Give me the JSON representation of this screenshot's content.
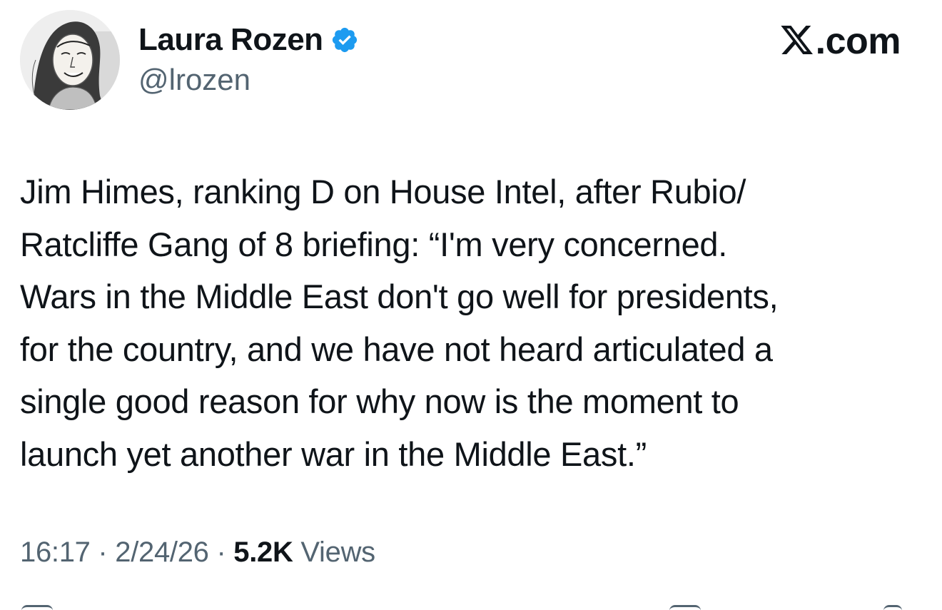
{
  "author": {
    "display_name": "Laura Rozen",
    "handle": "@lrozen",
    "verified": true,
    "verified_icon": "verified-badge-icon",
    "verified_color": "#1d9bf0"
  },
  "brand": {
    "text": ".com",
    "icon": "x-logo-icon"
  },
  "tweet": {
    "lines": [
      "Jim Himes, ranking D on House Intel, after Rubio/",
      "Ratcliffe Gang of 8 briefing: “I'm very concerned.",
      "Wars in the Middle East don't go well for presidents,",
      "for the country, and we have not heard articulated a",
      "single good reason for why now is the moment to",
      "launch yet another war in the Middle East.”"
    ]
  },
  "meta": {
    "time": "16:17",
    "separator": " · ",
    "date": "2/24/26",
    "views_count": "5.2K",
    "views_label": " Views"
  },
  "colors": {
    "text_primary": "#0f1419",
    "text_secondary": "#536471",
    "accent": "#1d9bf0"
  }
}
